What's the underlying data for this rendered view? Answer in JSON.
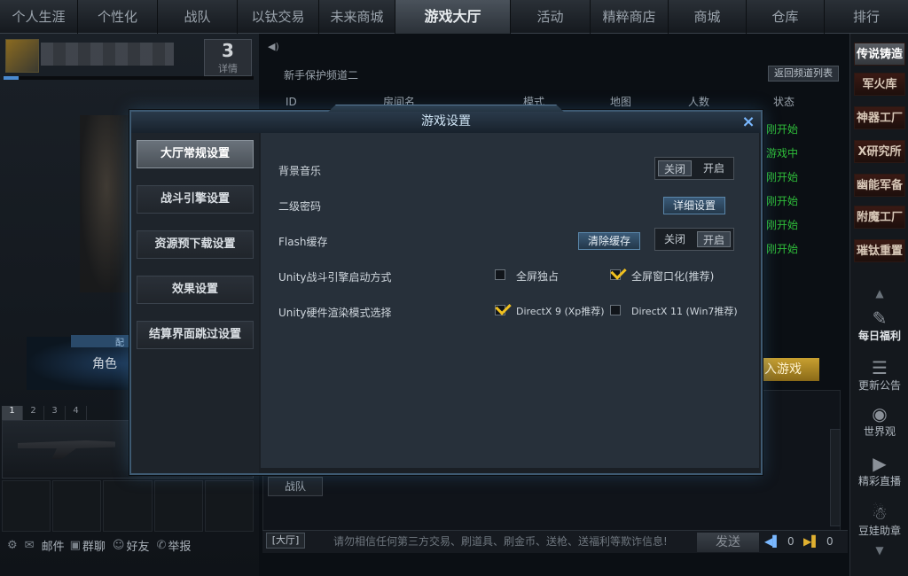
{
  "topnav": [
    "个人生涯",
    "个性化",
    "战队",
    "以钛交易",
    "未来商城",
    "游戏大厅",
    "活动",
    "精粹商店",
    "商城",
    "仓库",
    "排行"
  ],
  "topnav_active": "游戏大厅",
  "player": {
    "rank": "3",
    "rank_label": "详情",
    "role_label": "角色",
    "config_label": "配"
  },
  "weapon_slots": [
    "1",
    "2",
    "3",
    "4"
  ],
  "left_bottom": {
    "mail": "邮件",
    "mail_badge": "0",
    "guild_chat": "群聊",
    "friends": "好友",
    "report": "举报"
  },
  "lobby": {
    "channel": "新手保护频道二",
    "back_button": "返回频道列表",
    "columns": [
      "ID",
      "房间名",
      "模式",
      "地图",
      "人数",
      "状态"
    ],
    "statuses": [
      "刚开始",
      "游戏中",
      "刚开始",
      "刚开始",
      "刚开始",
      "刚开始",
      "刚开始"
    ],
    "join_button": "入游戏"
  },
  "right_tabs": [
    "传说铸造",
    "军火库",
    "神器工厂",
    "X研究所",
    "幽能军备",
    "附魔工厂",
    "璀钛重置"
  ],
  "right_icons": [
    "每日福利",
    "更新公告",
    "世界观",
    "精彩直播",
    "豆娃助章"
  ],
  "chat": {
    "tab": "战队",
    "channel": "[大厅]",
    "warning": "请勿相信任何第三方交易、刷道具、刷金币、送枪、送福利等欺诈信息!",
    "send": "发送",
    "vol1": "0",
    "vol2": "0"
  },
  "modal": {
    "title": "游戏设置",
    "close": "×",
    "nav": [
      "大厅常规设置",
      "战斗引擎设置",
      "资源预下载设置",
      "效果设置",
      "结算界面跳过设置"
    ],
    "nav_active": 0,
    "bgm_label": "背景音乐",
    "bgm_off": "关闭",
    "bgm_on": "开启",
    "bgm_state": "off",
    "password_label": "二级密码",
    "password_button": "详细设置",
    "flash_label": "Flash缓存",
    "flash_clear": "清除缓存",
    "flash_off": "关闭",
    "flash_on": "开启",
    "flash_state": "on",
    "unity_launch_label": "Unity战斗引擎启动方式",
    "fullscreen_exclusive": "全屏独占",
    "fullscreen_exclusive_checked": false,
    "fullscreen_window": "全屏窗口化(推荐)",
    "fullscreen_window_checked": true,
    "unity_render_label": "Unity硬件渲染模式选择",
    "dx9": "DirectX 9 (Xp推荐)",
    "dx9_checked": true,
    "dx11": "DirectX 11 (Win7推荐)",
    "dx11_checked": false
  }
}
